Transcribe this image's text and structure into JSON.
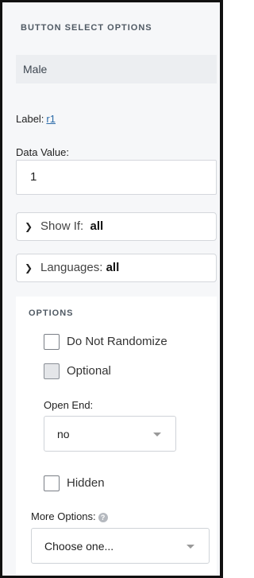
{
  "header": {
    "title": "BUTTON SELECT OPTIONS"
  },
  "option": {
    "name": "Male"
  },
  "label_field": {
    "label": "Label:",
    "value": "r1"
  },
  "data_value": {
    "label": "Data Value:",
    "value": "1"
  },
  "show_if": {
    "label": "Show If:",
    "value": "all"
  },
  "languages": {
    "label": "Languages:",
    "value": "all"
  },
  "options": {
    "title": "OPTIONS",
    "do_not_randomize": {
      "label": "Do Not Randomize",
      "checked": false
    },
    "optional": {
      "label": "Optional",
      "checked": false
    },
    "open_end": {
      "label": "Open End:",
      "selected": "no"
    },
    "hidden": {
      "label": "Hidden",
      "checked": false
    },
    "more_options": {
      "label": "More Options:",
      "selected": "Choose one...",
      "help_icon": "question-icon"
    }
  }
}
